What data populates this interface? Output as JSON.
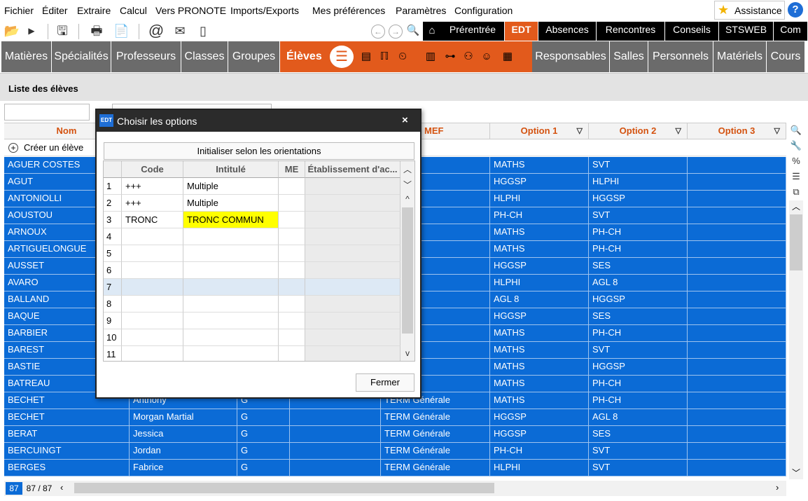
{
  "menubar": {
    "items": [
      "Fichier",
      "Éditer",
      "Extraire",
      "Calcul",
      "Vers PRONOTE",
      "Imports/Exports",
      "Mes préférences",
      "Paramètres",
      "Configuration"
    ],
    "assistance": "Assistance"
  },
  "modules": [
    "Prérentrée",
    "EDT",
    "Absences",
    "Rencontres",
    "Conseils",
    "STSWEB",
    "Com"
  ],
  "active_module": "EDT",
  "onglets": [
    "Matières",
    "Spécialités",
    "Professeurs",
    "Classes",
    "Groupes",
    "Élèves",
    "Responsables",
    "Salles",
    "Personnels",
    "Matériels",
    "Cours"
  ],
  "active_onglet": "Élèves",
  "page_title": "Liste des élèves",
  "grid": {
    "headers": [
      "Nom",
      "MEF",
      "Option 1",
      "Option 2",
      "Option 3"
    ],
    "create_label": "Créer un élève",
    "rows": [
      {
        "nom": "AGUER COSTES",
        "prenom": "",
        "sexe": "",
        "mef": "rale",
        "opt1": "MATHS",
        "opt2": "SVT"
      },
      {
        "nom": "AGUT",
        "prenom": "",
        "sexe": "",
        "mef": "rale",
        "opt1": "HGGSP",
        "opt2": "HLPHI"
      },
      {
        "nom": "ANTONIOLLI",
        "prenom": "",
        "sexe": "",
        "mef": "rale",
        "opt1": "HLPHI",
        "opt2": "HGGSP"
      },
      {
        "nom": "AOUSTOU",
        "prenom": "",
        "sexe": "",
        "mef": "rale",
        "opt1": "PH-CH",
        "opt2": "SVT"
      },
      {
        "nom": "ARNOUX",
        "prenom": "",
        "sexe": "",
        "mef": "rale",
        "opt1": "MATHS",
        "opt2": "PH-CH"
      },
      {
        "nom": "ARTIGUELONGUE",
        "prenom": "",
        "sexe": "",
        "mef": "rale",
        "opt1": "MATHS",
        "opt2": "PH-CH"
      },
      {
        "nom": "AUSSET",
        "prenom": "",
        "sexe": "",
        "mef": "rale",
        "opt1": "HGGSP",
        "opt2": "SES"
      },
      {
        "nom": "AVARO",
        "prenom": "",
        "sexe": "",
        "mef": "rale",
        "opt1": "HLPHI",
        "opt2": "AGL 8"
      },
      {
        "nom": "BALLAND",
        "prenom": "",
        "sexe": "",
        "mef": "rale",
        "opt1": "AGL 8",
        "opt2": "HGGSP"
      },
      {
        "nom": "BAQUE",
        "prenom": "",
        "sexe": "",
        "mef": "rale",
        "opt1": "HGGSP",
        "opt2": "SES"
      },
      {
        "nom": "BARBIER",
        "prenom": "",
        "sexe": "",
        "mef": "rale",
        "opt1": "MATHS",
        "opt2": "PH-CH"
      },
      {
        "nom": "BAREST",
        "prenom": "",
        "sexe": "",
        "mef": "rale",
        "opt1": "MATHS",
        "opt2": "SVT"
      },
      {
        "nom": "BASTIE",
        "prenom": "",
        "sexe": "",
        "mef": "rale",
        "opt1": "MATHS",
        "opt2": "HGGSP"
      },
      {
        "nom": "BATREAU",
        "prenom": "",
        "sexe": "",
        "mef": "rale",
        "opt1": "MATHS",
        "opt2": "PH-CH"
      },
      {
        "nom": "BECHET",
        "prenom": "Anthony",
        "sexe": "G",
        "mef": "TERM Générale",
        "opt1": "MATHS",
        "opt2": "PH-CH"
      },
      {
        "nom": "BECHET",
        "prenom": "Morgan Martial",
        "sexe": "G",
        "mef": "TERM Générale",
        "opt1": "HGGSP",
        "opt2": "AGL 8"
      },
      {
        "nom": "BERAT",
        "prenom": "Jessica",
        "sexe": "G",
        "mef": "TERM Générale",
        "opt1": "HGGSP",
        "opt2": "SES"
      },
      {
        "nom": "BERCUINGT",
        "prenom": "Jordan",
        "sexe": "G",
        "mef": "TERM Générale",
        "opt1": "PH-CH",
        "opt2": "SVT"
      },
      {
        "nom": "BERGES",
        "prenom": "Fabrice",
        "sexe": "G",
        "mef": "TERM Générale",
        "opt1": "HLPHI",
        "opt2": "SVT"
      }
    ]
  },
  "status": {
    "selected": "87",
    "total": "87 / 87"
  },
  "dialog": {
    "title": "Choisir les options",
    "icon_label": "EDT",
    "init_button": "Initialiser selon les orientations",
    "headers": [
      "Code",
      "Intitulé",
      "ME",
      "Établissement d'ac..."
    ],
    "rows": [
      {
        "num": "1",
        "code": "+++",
        "intitule": "Multiple"
      },
      {
        "num": "2",
        "code": "+++",
        "intitule": "Multiple"
      },
      {
        "num": "3",
        "code": "TRONC",
        "intitule": "TRONC COMMUN"
      },
      {
        "num": "4",
        "code": "",
        "intitule": ""
      },
      {
        "num": "5",
        "code": "",
        "intitule": ""
      },
      {
        "num": "6",
        "code": "",
        "intitule": ""
      },
      {
        "num": "7",
        "code": "",
        "intitule": ""
      },
      {
        "num": "8",
        "code": "",
        "intitule": ""
      },
      {
        "num": "9",
        "code": "",
        "intitule": ""
      },
      {
        "num": "10",
        "code": "",
        "intitule": ""
      },
      {
        "num": "11",
        "code": "",
        "intitule": ""
      }
    ],
    "close_button": "Fermer"
  },
  "colors": {
    "accent": "#e25a1c",
    "selection": "#0b6bd6",
    "highlight": "#ffff00"
  }
}
